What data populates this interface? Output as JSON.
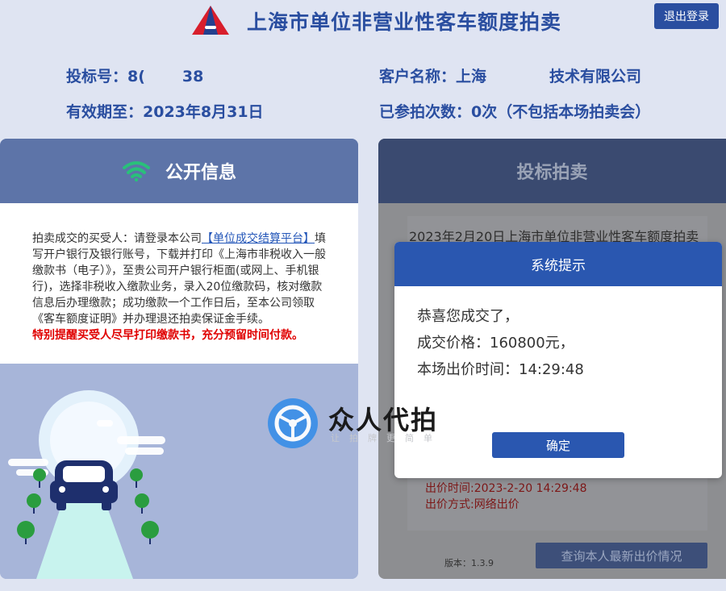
{
  "header": {
    "title": "上海市单位非营业性客车额度拍卖",
    "logout_label": "退出登录"
  },
  "info": {
    "bid_no_label": "投标号：",
    "bid_no_visible_start": "8(",
    "bid_no_visible_end": "38",
    "customer_label": "客户名称：",
    "customer_visible_start": "上海",
    "customer_visible_end": "技术有限公司",
    "valid_until": "有效期至：2023年8月31日",
    "participation": "已参拍次数：0次（不包括本场拍卖会）"
  },
  "public_info": {
    "title": "公开信息",
    "text_before_link": "拍卖成交的买受人：请登录本公司",
    "link": "【单位成交结算平台】",
    "text_after_link": "填写开户银行及银行账号，下载并打印《上海市非税收入一般缴款书（电子）》，至贵公司开户银行柜面(或网上、手机银行)，选择非税收入缴款业务，录入20位缴款码，核对缴款信息后办理缴款；成功缴款一个工作日后，至本公司领取《客车额度证明》并办理退还拍卖保证金手续。",
    "warning": "特别提醒买受人尽早打印缴款书，充分预留时间付款。"
  },
  "auction": {
    "tab_title": "投标拍卖",
    "session_title": "2023年2月20日上海市单位非营业性客车额度拍卖",
    "bid_time": "出价时间:2023-2-20 14:29:48",
    "bid_method": "出价方式:网络出价",
    "version": "版本：1.3.9",
    "query_label": "查询本人最新出价情况"
  },
  "modal": {
    "title": "系统提示",
    "line1": "恭喜您成交了，",
    "line2": "成交价格：160800元，",
    "line3": "本场出价时间：14:29:48",
    "confirm_label": "确定"
  },
  "watermark": {
    "name": "众人代拍",
    "slogan": "让拍牌更简单"
  },
  "colors": {
    "primary": "#2a57b0",
    "title_blue": "#2a4ea0",
    "warning_red": "#e00000",
    "wifi_green": "#29c07a"
  }
}
